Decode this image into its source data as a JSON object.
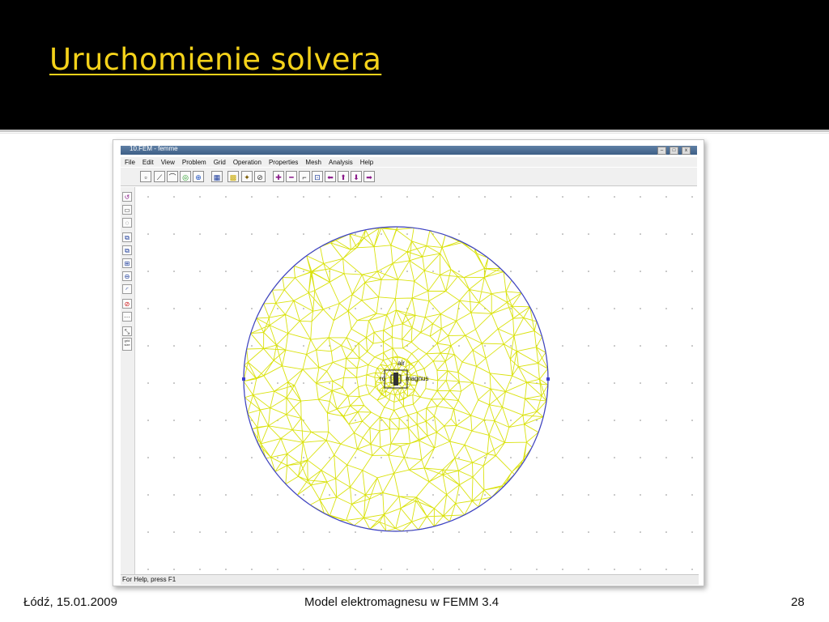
{
  "slide": {
    "title": "Uruchomienie solvera",
    "footer_date": "Łódź, 15.01.2009",
    "footer_title": "Model elektromagnesu w FEMM 3.4",
    "page_number": "28"
  },
  "window": {
    "title": "10.FEM - femme",
    "menu": [
      "File",
      "Edit",
      "View",
      "Problem",
      "Grid",
      "Operation",
      "Properties",
      "Mesh",
      "Analysis",
      "Help"
    ],
    "status_text": "For Help, press F1"
  },
  "toolbar": {
    "buttons": [
      {
        "name": "node-mode-icon",
        "glyph": "▫",
        "color": "#222222"
      },
      {
        "name": "segment-mode-icon",
        "glyph": "⟋",
        "color": "#222222"
      },
      {
        "name": "arc-mode-icon",
        "glyph": "⌒",
        "color": "#222222"
      },
      {
        "name": "block-label-mode-icon",
        "glyph": "◎",
        "color": "#1f9a1f"
      },
      {
        "name": "group-mode-icon",
        "glyph": "⊕",
        "color": "#1a4fbf"
      },
      {
        "name": "show-mesh-icon",
        "glyph": "▦",
        "color": "#1a3a9a"
      },
      {
        "name": "mesh-icon",
        "glyph": "▩",
        "color": "#c8a800"
      },
      {
        "name": "run-solver-icon",
        "glyph": "✦",
        "color": "#7a5a00"
      },
      {
        "name": "view-results-icon",
        "glyph": "⊘",
        "color": "#333333"
      },
      {
        "name": "zoom-in-icon",
        "glyph": "✚",
        "color": "#8a1a8a"
      },
      {
        "name": "zoom-out-icon",
        "glyph": "━",
        "color": "#8a1a8a"
      },
      {
        "name": "zoom-natural-icon",
        "glyph": "⌐",
        "color": "#333333"
      },
      {
        "name": "zoom-window-icon",
        "glyph": "⊡",
        "color": "#1a3a9a"
      },
      {
        "name": "pan-left-icon",
        "glyph": "⬅",
        "color": "#8a1a8a"
      },
      {
        "name": "pan-up-icon",
        "glyph": "⬆",
        "color": "#8a1a8a"
      },
      {
        "name": "pan-down-icon",
        "glyph": "⬇",
        "color": "#8a1a8a"
      },
      {
        "name": "pan-right-icon",
        "glyph": "➡",
        "color": "#8a1a8a"
      }
    ]
  },
  "left_toolbar": {
    "buttons": [
      {
        "name": "undo-icon",
        "glyph": "↺",
        "color": "#8a1a8a"
      },
      {
        "name": "select-icon",
        "glyph": "▭",
        "color": "#333333"
      },
      {
        "name": "select-circle-icon",
        "glyph": "◌",
        "color": "#333333"
      },
      {
        "name": "move-icon",
        "glyph": "⧉",
        "color": "#1a3a9a"
      },
      {
        "name": "copy-icon",
        "glyph": "⧉",
        "color": "#1a3a9a"
      },
      {
        "name": "scale-icon",
        "glyph": "⊞",
        "color": "#1a3a9a"
      },
      {
        "name": "mirror-icon",
        "glyph": "⊖",
        "color": "#1a3a9a"
      },
      {
        "name": "fillet-icon",
        "glyph": "◜",
        "color": "#1a3a9a"
      },
      {
        "name": "delete-icon",
        "glyph": "⊘",
        "color": "#cc1111"
      },
      {
        "name": "grid-icon",
        "glyph": "⋯",
        "color": "#555555"
      },
      {
        "name": "snap-grid-icon",
        "glyph": "⤡",
        "color": "#333333"
      },
      {
        "name": "grid-size-icon",
        "glyph": "grid size",
        "color": "#333333"
      }
    ]
  },
  "canvas": {
    "labels": [
      "air",
      "magnus",
      "ro"
    ],
    "colors": {
      "boundary": "#3b3fcf",
      "mesh": "#d8e000",
      "mesh_edge": "#c9d100"
    }
  }
}
